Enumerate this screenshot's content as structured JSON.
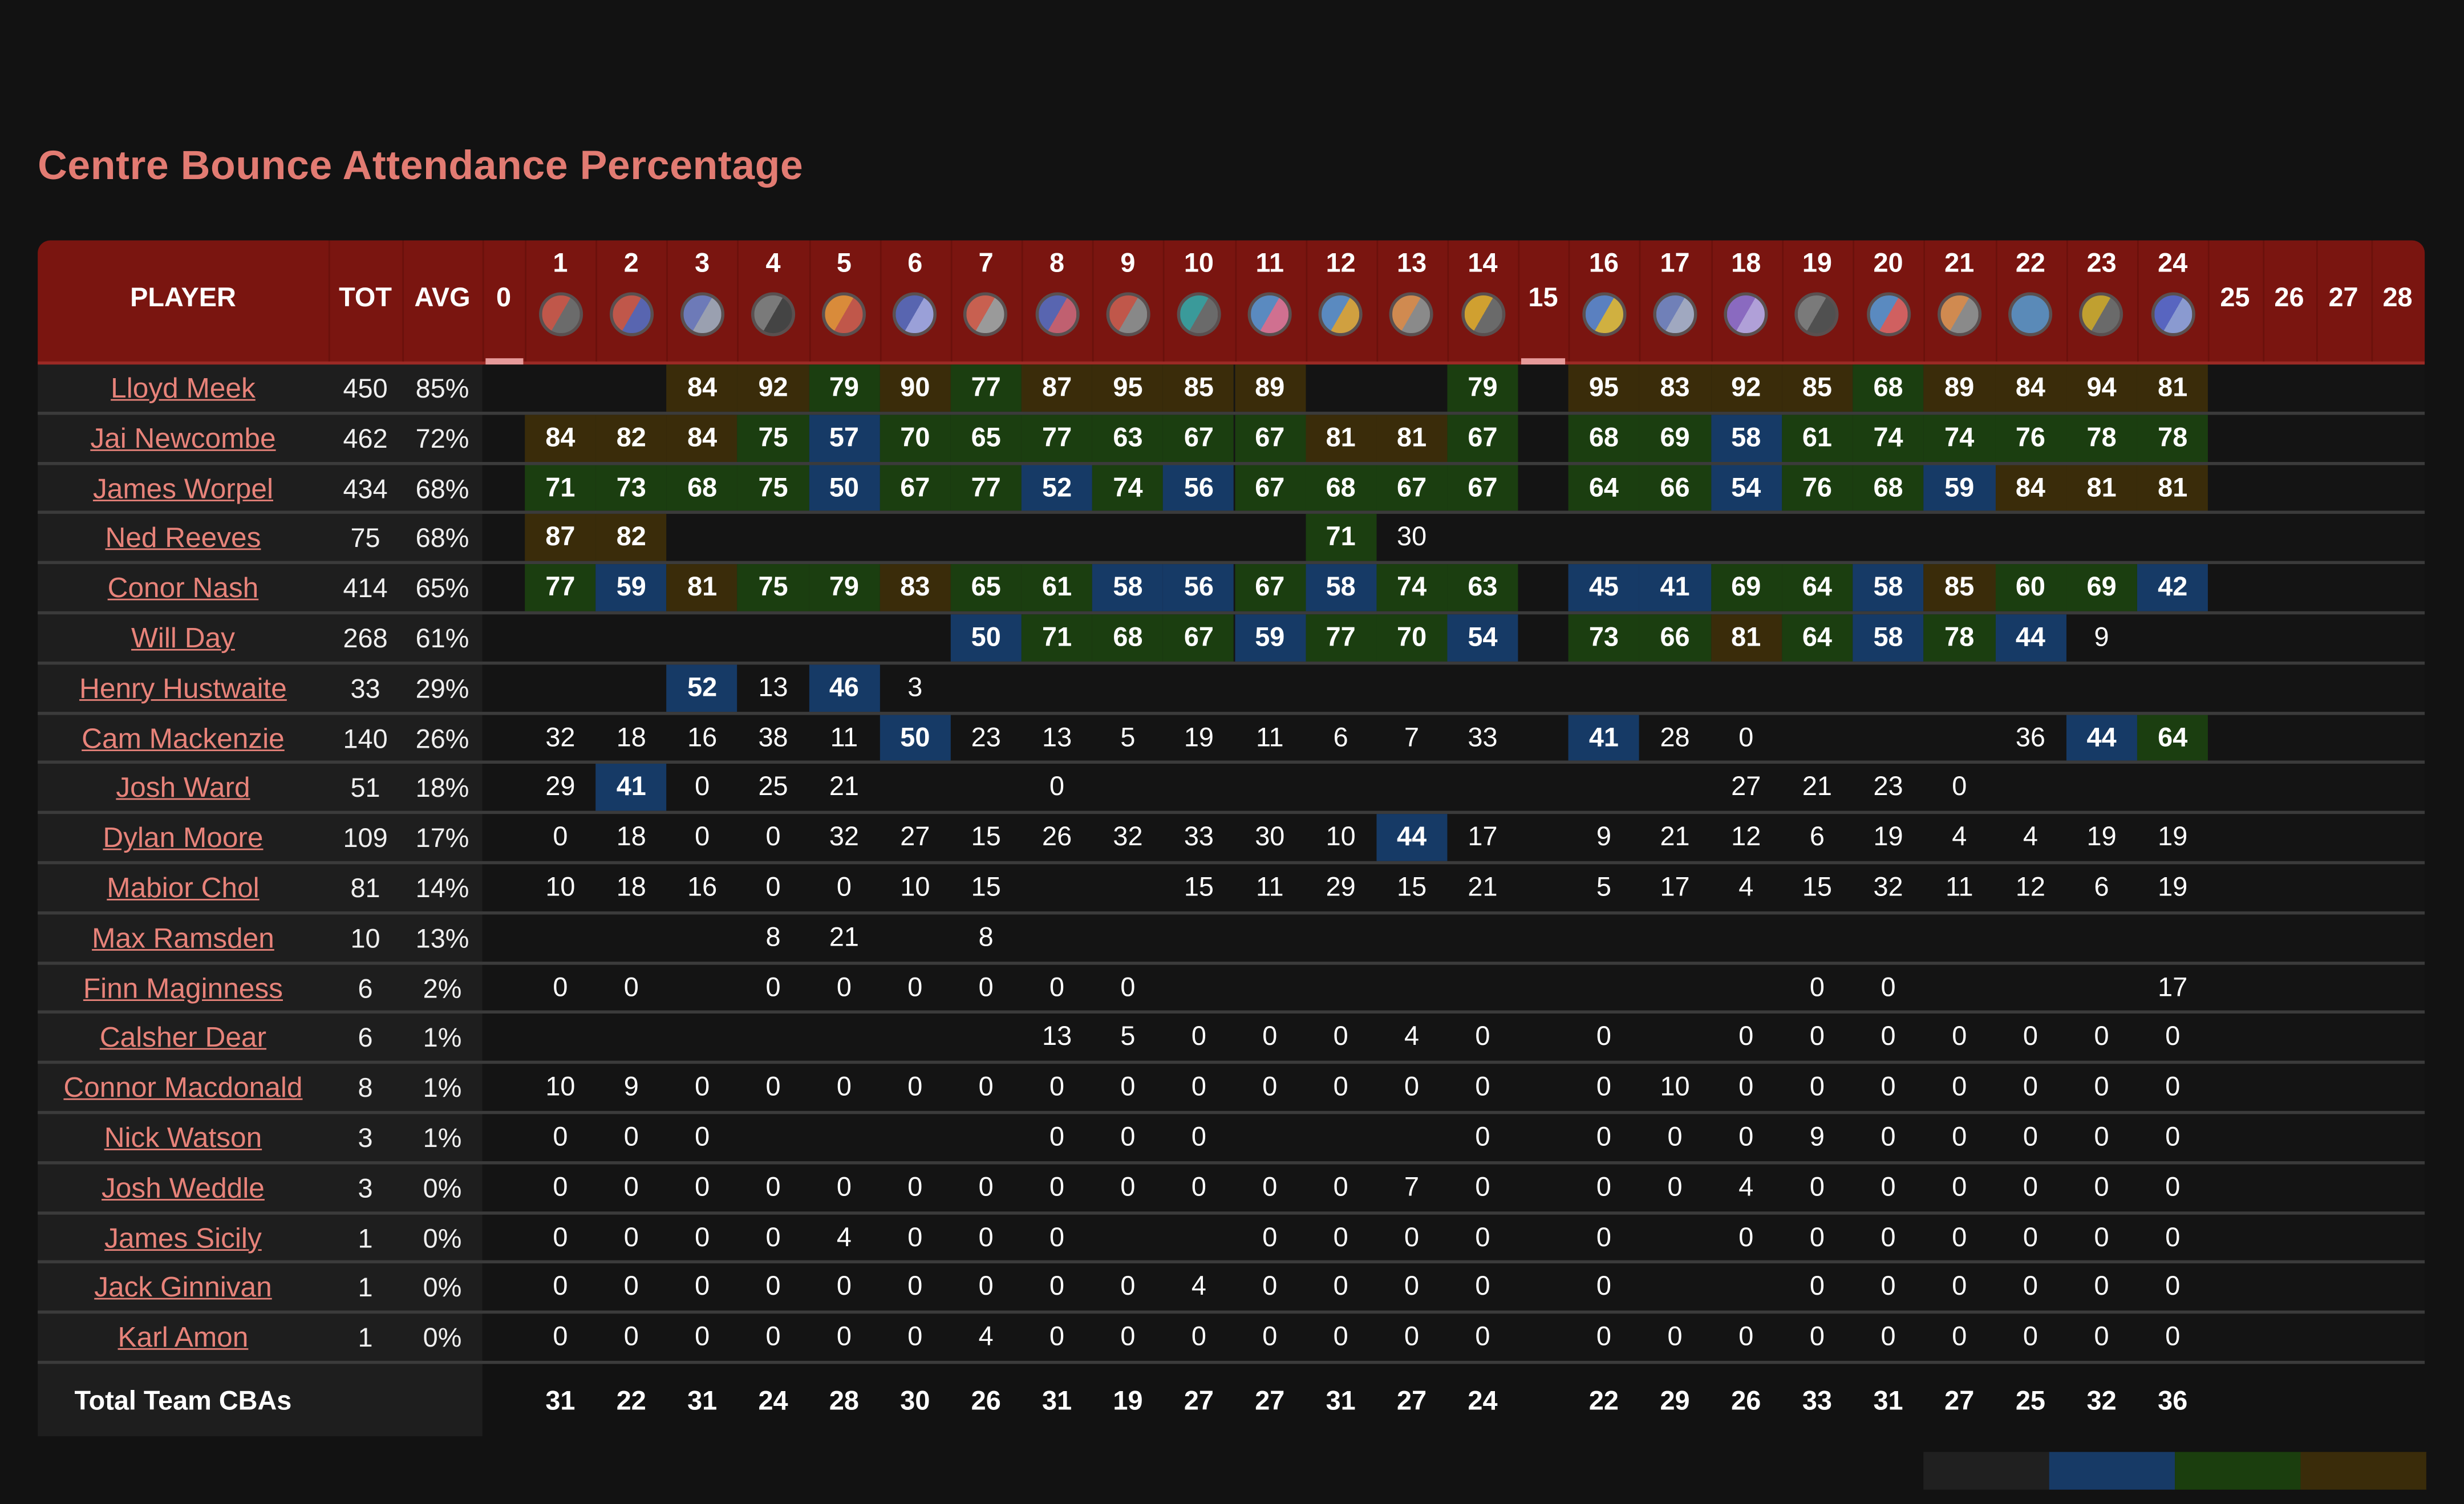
{
  "title": "Centre Bounce Attendance Percentage",
  "header": {
    "player": "PLAYER",
    "tot": "TOT",
    "avg": "AVG"
  },
  "rounds": [
    "0",
    "1",
    "2",
    "3",
    "4",
    "5",
    "6",
    "7",
    "8",
    "9",
    "10",
    "11",
    "12",
    "13",
    "14",
    "15",
    "16",
    "17",
    "18",
    "19",
    "20",
    "21",
    "22",
    "23",
    "24",
    "25",
    "26",
    "27",
    "28"
  ],
  "bye_rounds": [
    "0",
    "15",
    "25",
    "26",
    "27",
    "28"
  ],
  "round_logos": {
    "1": [
      "#c0574a",
      "#6b6b6b"
    ],
    "2": [
      "#c0574a",
      "#5865b0"
    ],
    "3": [
      "#6d7ab8",
      "#9aa0b0"
    ],
    "4": [
      "#7a7a7a",
      "#444"
    ],
    "5": [
      "#d98b3a",
      "#c0574a"
    ],
    "6": [
      "#5865b0",
      "#9aa0d8"
    ],
    "7": [
      "#c86050",
      "#9a9a9a"
    ],
    "8": [
      "#5865b0",
      "#c06070"
    ],
    "9": [
      "#c0574a",
      "#888"
    ],
    "10": [
      "#3a9a9a",
      "#6a6a6a"
    ],
    "11": [
      "#5a8ac0",
      "#d07090"
    ],
    "12": [
      "#5a8ac0",
      "#d0a040"
    ],
    "13": [
      "#d08a50",
      "#8a8a8a"
    ],
    "14": [
      "#d0a030",
      "#6a6a6a"
    ],
    "16": [
      "#5a80c0",
      "#d0b040"
    ],
    "17": [
      "#7080b8",
      "#a0a8c0"
    ],
    "18": [
      "#8a6ac0",
      "#b0a0d8"
    ],
    "19": [
      "#7a7a7a",
      "#505050"
    ],
    "20": [
      "#5a8ac0",
      "#d06060"
    ],
    "21": [
      "#d08a50",
      "#8a8a8a"
    ],
    "22": [
      "#5a8ab8",
      "#5a8ab8"
    ],
    "23": [
      "#c0a030",
      "#6a6a6a"
    ],
    "24": [
      "#5865c0",
      "#8a9ad0"
    ]
  },
  "colors": {
    "low": "#141414",
    "blue": "#163a66",
    "green": "#1b3e10",
    "gold": "#3a2c0a",
    "header": "#7a1510",
    "name": "#e8837a"
  },
  "thresholds": {
    "blue": 40,
    "green": 60,
    "gold": 80
  },
  "players": [
    {
      "name": "Lloyd Meek",
      "tot": "450",
      "avg": "85%",
      "r": {
        "3": 84,
        "4": 92,
        "5": 79,
        "6": 90,
        "7": 77,
        "8": 87,
        "9": 95,
        "10": 85,
        "11": 89,
        "14": 79,
        "16": 95,
        "17": 83,
        "18": 92,
        "19": 85,
        "20": 68,
        "21": 89,
        "22": 84,
        "23": 94,
        "24": 81
      }
    },
    {
      "name": "Jai Newcombe",
      "tot": "462",
      "avg": "72%",
      "r": {
        "1": 84,
        "2": 82,
        "3": 84,
        "4": 75,
        "5": 57,
        "6": 70,
        "7": 65,
        "8": 77,
        "9": 63,
        "10": 67,
        "11": 67,
        "12": 81,
        "13": 81,
        "14": 67,
        "16": 68,
        "17": 69,
        "18": 58,
        "19": 61,
        "20": 74,
        "21": 74,
        "22": 76,
        "23": 78,
        "24": 78
      }
    },
    {
      "name": "James Worpel",
      "tot": "434",
      "avg": "68%",
      "r": {
        "1": 71,
        "2": 73,
        "3": 68,
        "4": 75,
        "5": 50,
        "6": 67,
        "7": 77,
        "8": 52,
        "9": 74,
        "10": 56,
        "11": 67,
        "12": 68,
        "13": 67,
        "14": 67,
        "16": 64,
        "17": 66,
        "18": 54,
        "19": 76,
        "20": 68,
        "21": 59,
        "22": 84,
        "23": 81,
        "24": 81
      }
    },
    {
      "name": "Ned Reeves",
      "tot": "75",
      "avg": "68%",
      "r": {
        "1": 87,
        "2": 82,
        "12": 71,
        "13": 30
      }
    },
    {
      "name": "Conor Nash",
      "tot": "414",
      "avg": "65%",
      "r": {
        "1": 77,
        "2": 59,
        "3": 81,
        "4": 75,
        "5": 79,
        "6": 83,
        "7": 65,
        "8": 61,
        "9": 58,
        "10": 56,
        "11": 67,
        "12": 58,
        "13": 74,
        "14": 63,
        "16": 45,
        "17": 41,
        "18": 69,
        "19": 64,
        "20": 58,
        "21": 85,
        "22": 60,
        "23": 69,
        "24": 42
      }
    },
    {
      "name": "Will Day",
      "tot": "268",
      "avg": "61%",
      "r": {
        "7": 50,
        "8": 71,
        "9": 68,
        "10": 67,
        "11": 59,
        "12": 77,
        "13": 70,
        "14": 54,
        "16": 73,
        "17": 66,
        "18": 81,
        "19": 64,
        "20": 58,
        "21": 78,
        "22": 44,
        "23": 9
      }
    },
    {
      "name": "Henry Hustwaite",
      "tot": "33",
      "avg": "29%",
      "r": {
        "3": 52,
        "4": 13,
        "5": 46,
        "6": 3
      }
    },
    {
      "name": "Cam Mackenzie",
      "tot": "140",
      "avg": "26%",
      "r": {
        "1": 32,
        "2": 18,
        "3": 16,
        "4": 38,
        "5": 11,
        "6": 50,
        "7": 23,
        "8": 13,
        "9": 5,
        "10": 19,
        "11": 11,
        "12": 6,
        "13": 7,
        "14": 33,
        "16": 41,
        "17": 28,
        "18": 0,
        "22": 36,
        "23": 44,
        "24": 64
      }
    },
    {
      "name": "Josh Ward",
      "tot": "51",
      "avg": "18%",
      "r": {
        "1": 29,
        "2": 41,
        "3": 0,
        "4": 25,
        "5": 21,
        "8": 0,
        "18": 27,
        "19": 21,
        "20": 23,
        "21": 0
      }
    },
    {
      "name": "Dylan Moore",
      "tot": "109",
      "avg": "17%",
      "r": {
        "1": 0,
        "2": 18,
        "3": 0,
        "4": 0,
        "5": 32,
        "6": 27,
        "7": 15,
        "8": 26,
        "9": 32,
        "10": 33,
        "11": 30,
        "12": 10,
        "13": 44,
        "14": 17,
        "16": 9,
        "17": 21,
        "18": 12,
        "19": 6,
        "20": 19,
        "21": 4,
        "22": 4,
        "23": 19,
        "24": 19
      }
    },
    {
      "name": "Mabior Chol",
      "tot": "81",
      "avg": "14%",
      "r": {
        "1": 10,
        "2": 18,
        "3": 16,
        "4": 0,
        "5": 0,
        "6": 10,
        "7": 15,
        "10": 15,
        "11": 11,
        "12": 29,
        "13": 15,
        "14": 21,
        "16": 5,
        "17": 17,
        "18": 4,
        "19": 15,
        "20": 32,
        "21": 11,
        "22": 12,
        "23": 6,
        "24": 19
      }
    },
    {
      "name": "Max Ramsden",
      "tot": "10",
      "avg": "13%",
      "r": {
        "4": 8,
        "5": 21,
        "7": 8
      }
    },
    {
      "name": "Finn Maginness",
      "tot": "6",
      "avg": "2%",
      "r": {
        "1": 0,
        "2": 0,
        "4": 0,
        "5": 0,
        "6": 0,
        "7": 0,
        "8": 0,
        "9": 0,
        "19": 0,
        "20": 0,
        "24": 17
      }
    },
    {
      "name": "Calsher Dear",
      "tot": "6",
      "avg": "1%",
      "r": {
        "8": 13,
        "9": 5,
        "10": 0,
        "11": 0,
        "12": 0,
        "13": 4,
        "14": 0,
        "16": 0,
        "18": 0,
        "19": 0,
        "20": 0,
        "21": 0,
        "22": 0,
        "23": 0,
        "24": 0
      }
    },
    {
      "name": "Connor Macdonald",
      "tot": "8",
      "avg": "1%",
      "r": {
        "1": 10,
        "2": 9,
        "3": 0,
        "4": 0,
        "5": 0,
        "6": 0,
        "7": 0,
        "8": 0,
        "9": 0,
        "10": 0,
        "11": 0,
        "12": 0,
        "13": 0,
        "14": 0,
        "16": 0,
        "17": 10,
        "18": 0,
        "19": 0,
        "20": 0,
        "21": 0,
        "22": 0,
        "23": 0,
        "24": 0
      }
    },
    {
      "name": "Nick Watson",
      "tot": "3",
      "avg": "1%",
      "r": {
        "1": 0,
        "2": 0,
        "3": 0,
        "8": 0,
        "9": 0,
        "10": 0,
        "14": 0,
        "16": 0,
        "17": 0,
        "18": 0,
        "19": 9,
        "20": 0,
        "21": 0,
        "22": 0,
        "23": 0,
        "24": 0
      }
    },
    {
      "name": "Josh Weddle",
      "tot": "3",
      "avg": "0%",
      "r": {
        "1": 0,
        "2": 0,
        "3": 0,
        "4": 0,
        "5": 0,
        "6": 0,
        "7": 0,
        "8": 0,
        "9": 0,
        "10": 0,
        "11": 0,
        "12": 0,
        "13": 7,
        "14": 0,
        "16": 0,
        "17": 0,
        "18": 4,
        "19": 0,
        "20": 0,
        "21": 0,
        "22": 0,
        "23": 0,
        "24": 0
      }
    },
    {
      "name": "James Sicily",
      "tot": "1",
      "avg": "0%",
      "r": {
        "1": 0,
        "2": 0,
        "3": 0,
        "4": 0,
        "5": 4,
        "6": 0,
        "7": 0,
        "8": 0,
        "11": 0,
        "12": 0,
        "13": 0,
        "14": 0,
        "16": 0,
        "18": 0,
        "19": 0,
        "20": 0,
        "21": 0,
        "22": 0,
        "23": 0,
        "24": 0
      }
    },
    {
      "name": "Jack Ginnivan",
      "tot": "1",
      "avg": "0%",
      "r": {
        "1": 0,
        "2": 0,
        "3": 0,
        "4": 0,
        "5": 0,
        "6": 0,
        "7": 0,
        "8": 0,
        "9": 0,
        "10": 4,
        "11": 0,
        "12": 0,
        "13": 0,
        "14": 0,
        "16": 0,
        "19": 0,
        "20": 0,
        "21": 0,
        "22": 0,
        "23": 0,
        "24": 0
      }
    },
    {
      "name": "Karl Amon",
      "tot": "1",
      "avg": "0%",
      "r": {
        "1": 0,
        "2": 0,
        "3": 0,
        "4": 0,
        "5": 0,
        "6": 0,
        "7": 4,
        "8": 0,
        "9": 0,
        "10": 0,
        "11": 0,
        "12": 0,
        "13": 0,
        "14": 0,
        "16": 0,
        "17": 0,
        "18": 0,
        "19": 0,
        "20": 0,
        "21": 0,
        "22": 0,
        "23": 0,
        "24": 0
      }
    }
  ],
  "totals": {
    "label": "Total Team CBAs",
    "r": {
      "1": 31,
      "2": 22,
      "3": 31,
      "4": 24,
      "5": 28,
      "6": 30,
      "7": 26,
      "8": 31,
      "9": 19,
      "10": 27,
      "11": 27,
      "12": 31,
      "13": 27,
      "14": 24,
      "16": 22,
      "17": 29,
      "18": 26,
      "19": 33,
      "20": 31,
      "21": 27,
      "22": 25,
      "23": 32,
      "24": 36
    }
  },
  "legend": {
    "colors": [
      "#202020",
      "#173a66",
      "#1b3e0e",
      "#3a2c0a"
    ]
  }
}
